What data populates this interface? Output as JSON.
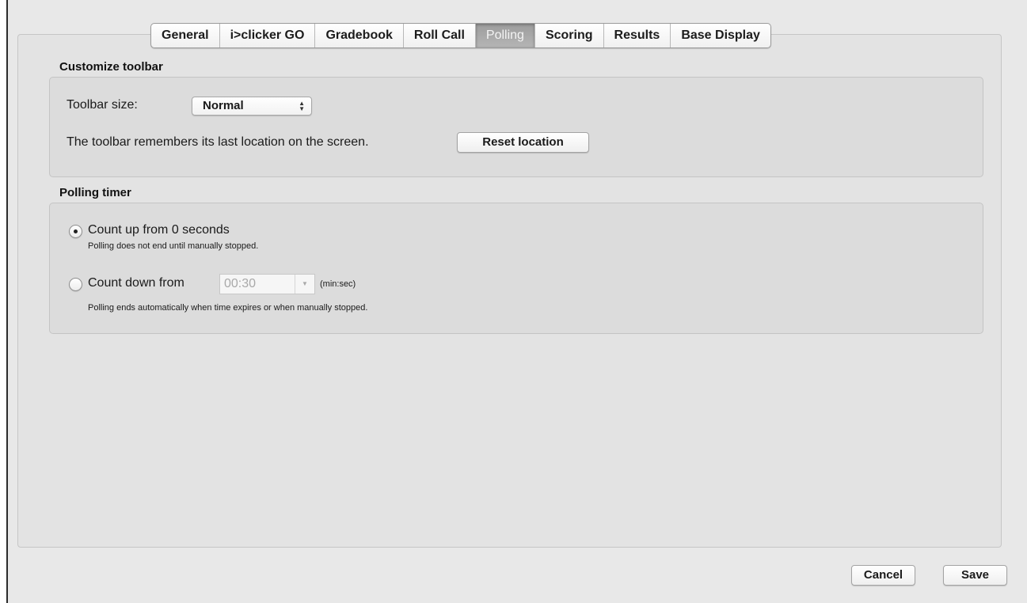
{
  "tabs": [
    {
      "label": "General",
      "active": false
    },
    {
      "label": "i>clicker GO",
      "active": false
    },
    {
      "label": "Gradebook",
      "active": false
    },
    {
      "label": "Roll Call",
      "active": false
    },
    {
      "label": "Polling",
      "active": true
    },
    {
      "label": "Scoring",
      "active": false
    },
    {
      "label": "Results",
      "active": false
    },
    {
      "label": "Base Display",
      "active": false
    }
  ],
  "toolbar_section": {
    "title": "Customize toolbar",
    "size_label": "Toolbar size:",
    "size_value": "Normal",
    "location_text": "The toolbar remembers its last location on the screen.",
    "reset_button": "Reset location"
  },
  "timer_section": {
    "title": "Polling timer",
    "count_up": {
      "label": "Count up from 0 seconds",
      "hint": "Polling does not end until manually stopped.",
      "selected": true
    },
    "count_down": {
      "label": "Count down from",
      "value": "00:30",
      "unit": "(min:sec)",
      "hint": "Polling ends automatically when time expires or when manually stopped.",
      "selected": false
    }
  },
  "footer": {
    "cancel": "Cancel",
    "save": "Save"
  }
}
